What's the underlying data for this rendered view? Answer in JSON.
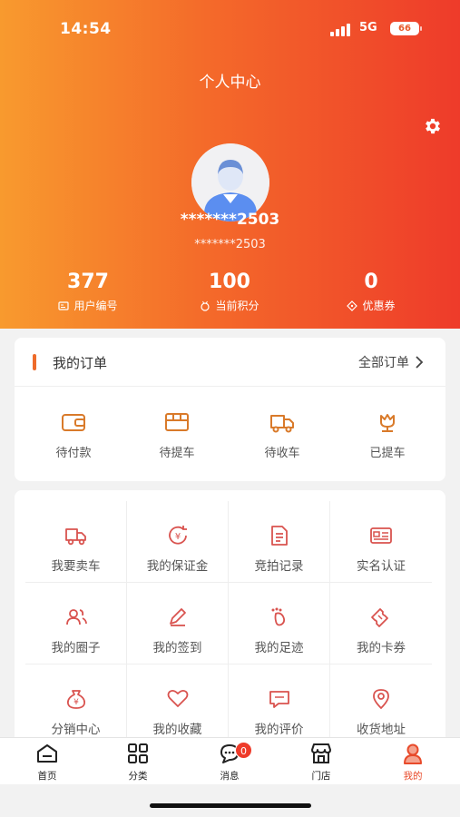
{
  "status_bar": {
    "time": "14:54",
    "network": "5G",
    "battery": "66"
  },
  "header": {
    "title": "个人中心",
    "settings_icon": "gear-icon"
  },
  "profile": {
    "username": "*******2503",
    "sub": "*******2503"
  },
  "stats": [
    {
      "value": "377",
      "label": "用户编号",
      "icon": "id-icon"
    },
    {
      "value": "100",
      "label": "当前积分",
      "icon": "medal-icon"
    },
    {
      "value": "0",
      "label": "优惠券",
      "icon": "ticket-icon"
    }
  ],
  "orders": {
    "title": "我的订单",
    "all_label": "全部订单",
    "items": [
      {
        "label": "待付款",
        "icon": "wallet-icon"
      },
      {
        "label": "待提车",
        "icon": "box-icon"
      },
      {
        "label": "待收车",
        "icon": "truck-icon"
      },
      {
        "label": "已提车",
        "icon": "flower-icon"
      }
    ]
  },
  "services": [
    {
      "label": "我要卖车",
      "icon": "truck-icon"
    },
    {
      "label": "我的保证金",
      "icon": "yen-refresh-icon"
    },
    {
      "label": "竞拍记录",
      "icon": "document-icon"
    },
    {
      "label": "实名认证",
      "icon": "id-card-icon"
    },
    {
      "label": "我的圈子",
      "icon": "users-icon"
    },
    {
      "label": "我的签到",
      "icon": "pencil-icon"
    },
    {
      "label": "我的足迹",
      "icon": "footprint-icon"
    },
    {
      "label": "我的卡券",
      "icon": "coupon-icon"
    },
    {
      "label": "分销中心",
      "icon": "money-bag-icon"
    },
    {
      "label": "我的收藏",
      "icon": "heart-icon"
    },
    {
      "label": "我的评价",
      "icon": "comment-icon"
    },
    {
      "label": "收货地址",
      "icon": "location-icon"
    }
  ],
  "tabbar": {
    "items": [
      {
        "label": "首页",
        "icon": "home-icon"
      },
      {
        "label": "分类",
        "icon": "grid-icon"
      },
      {
        "label": "消息",
        "icon": "message-icon",
        "badge": "0"
      },
      {
        "label": "门店",
        "icon": "store-icon"
      },
      {
        "label": "我的",
        "icon": "profile-icon",
        "active": true
      }
    ]
  },
  "colors": {
    "accent": "#ee3b2a",
    "gradient_start": "#f89a2e",
    "icon": "#d9534f"
  }
}
